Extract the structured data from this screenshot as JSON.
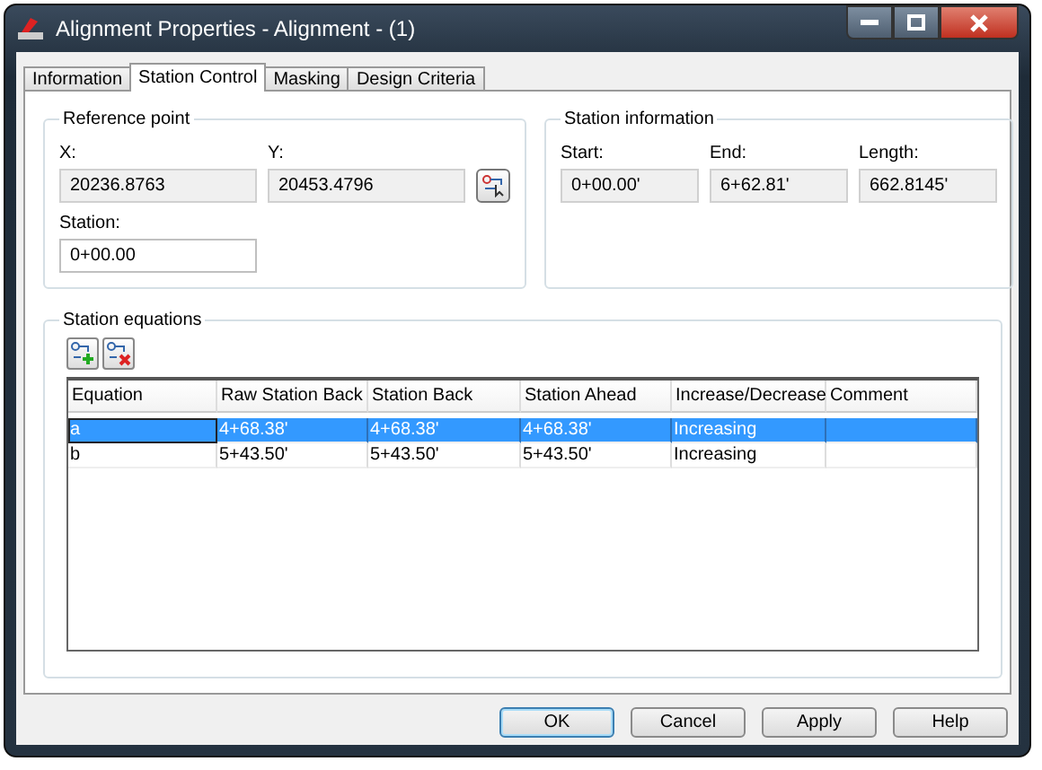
{
  "window": {
    "title": "Alignment Properties - Alignment - (1)"
  },
  "tabs": [
    {
      "label": "Information",
      "selected": false
    },
    {
      "label": "Station Control",
      "selected": true
    },
    {
      "label": "Masking",
      "selected": false
    },
    {
      "label": "Design Criteria",
      "selected": false
    }
  ],
  "reference_point": {
    "title": "Reference point",
    "fields": [
      {
        "label": "X:",
        "value": "20236.8763",
        "editable": false
      },
      {
        "label": "Y:",
        "value": "20453.4796",
        "editable": false
      }
    ],
    "station": {
      "label": "Station:",
      "value": "0+00.00",
      "editable": true
    }
  },
  "station_information": {
    "title": "Station information",
    "fields": [
      {
        "label": "Start:",
        "value": "0+00.00'",
        "editable": false
      },
      {
        "label": "End:",
        "value": "6+62.81'",
        "editable": false
      },
      {
        "label": "Length:",
        "value": "662.8145'",
        "editable": false
      }
    ]
  },
  "station_equations": {
    "title": "Station equations",
    "columns": [
      "Equation",
      "Raw Station Back",
      "Station Back",
      "Station Ahead",
      "Increase/Decrease",
      "Comment"
    ],
    "rows": [
      {
        "selected": true,
        "cells": [
          "a",
          "4+68.38'",
          "4+68.38'",
          "4+68.38'",
          "Increasing",
          ""
        ]
      },
      {
        "selected": false,
        "cells": [
          "b",
          "5+43.50'",
          "5+43.50'",
          "5+43.50'",
          "Increasing",
          ""
        ]
      }
    ]
  },
  "buttons": [
    {
      "label": "OK",
      "focused": true
    },
    {
      "label": "Cancel",
      "focused": false
    },
    {
      "label": "Apply",
      "focused": false
    },
    {
      "label": "Help",
      "focused": false
    }
  ]
}
